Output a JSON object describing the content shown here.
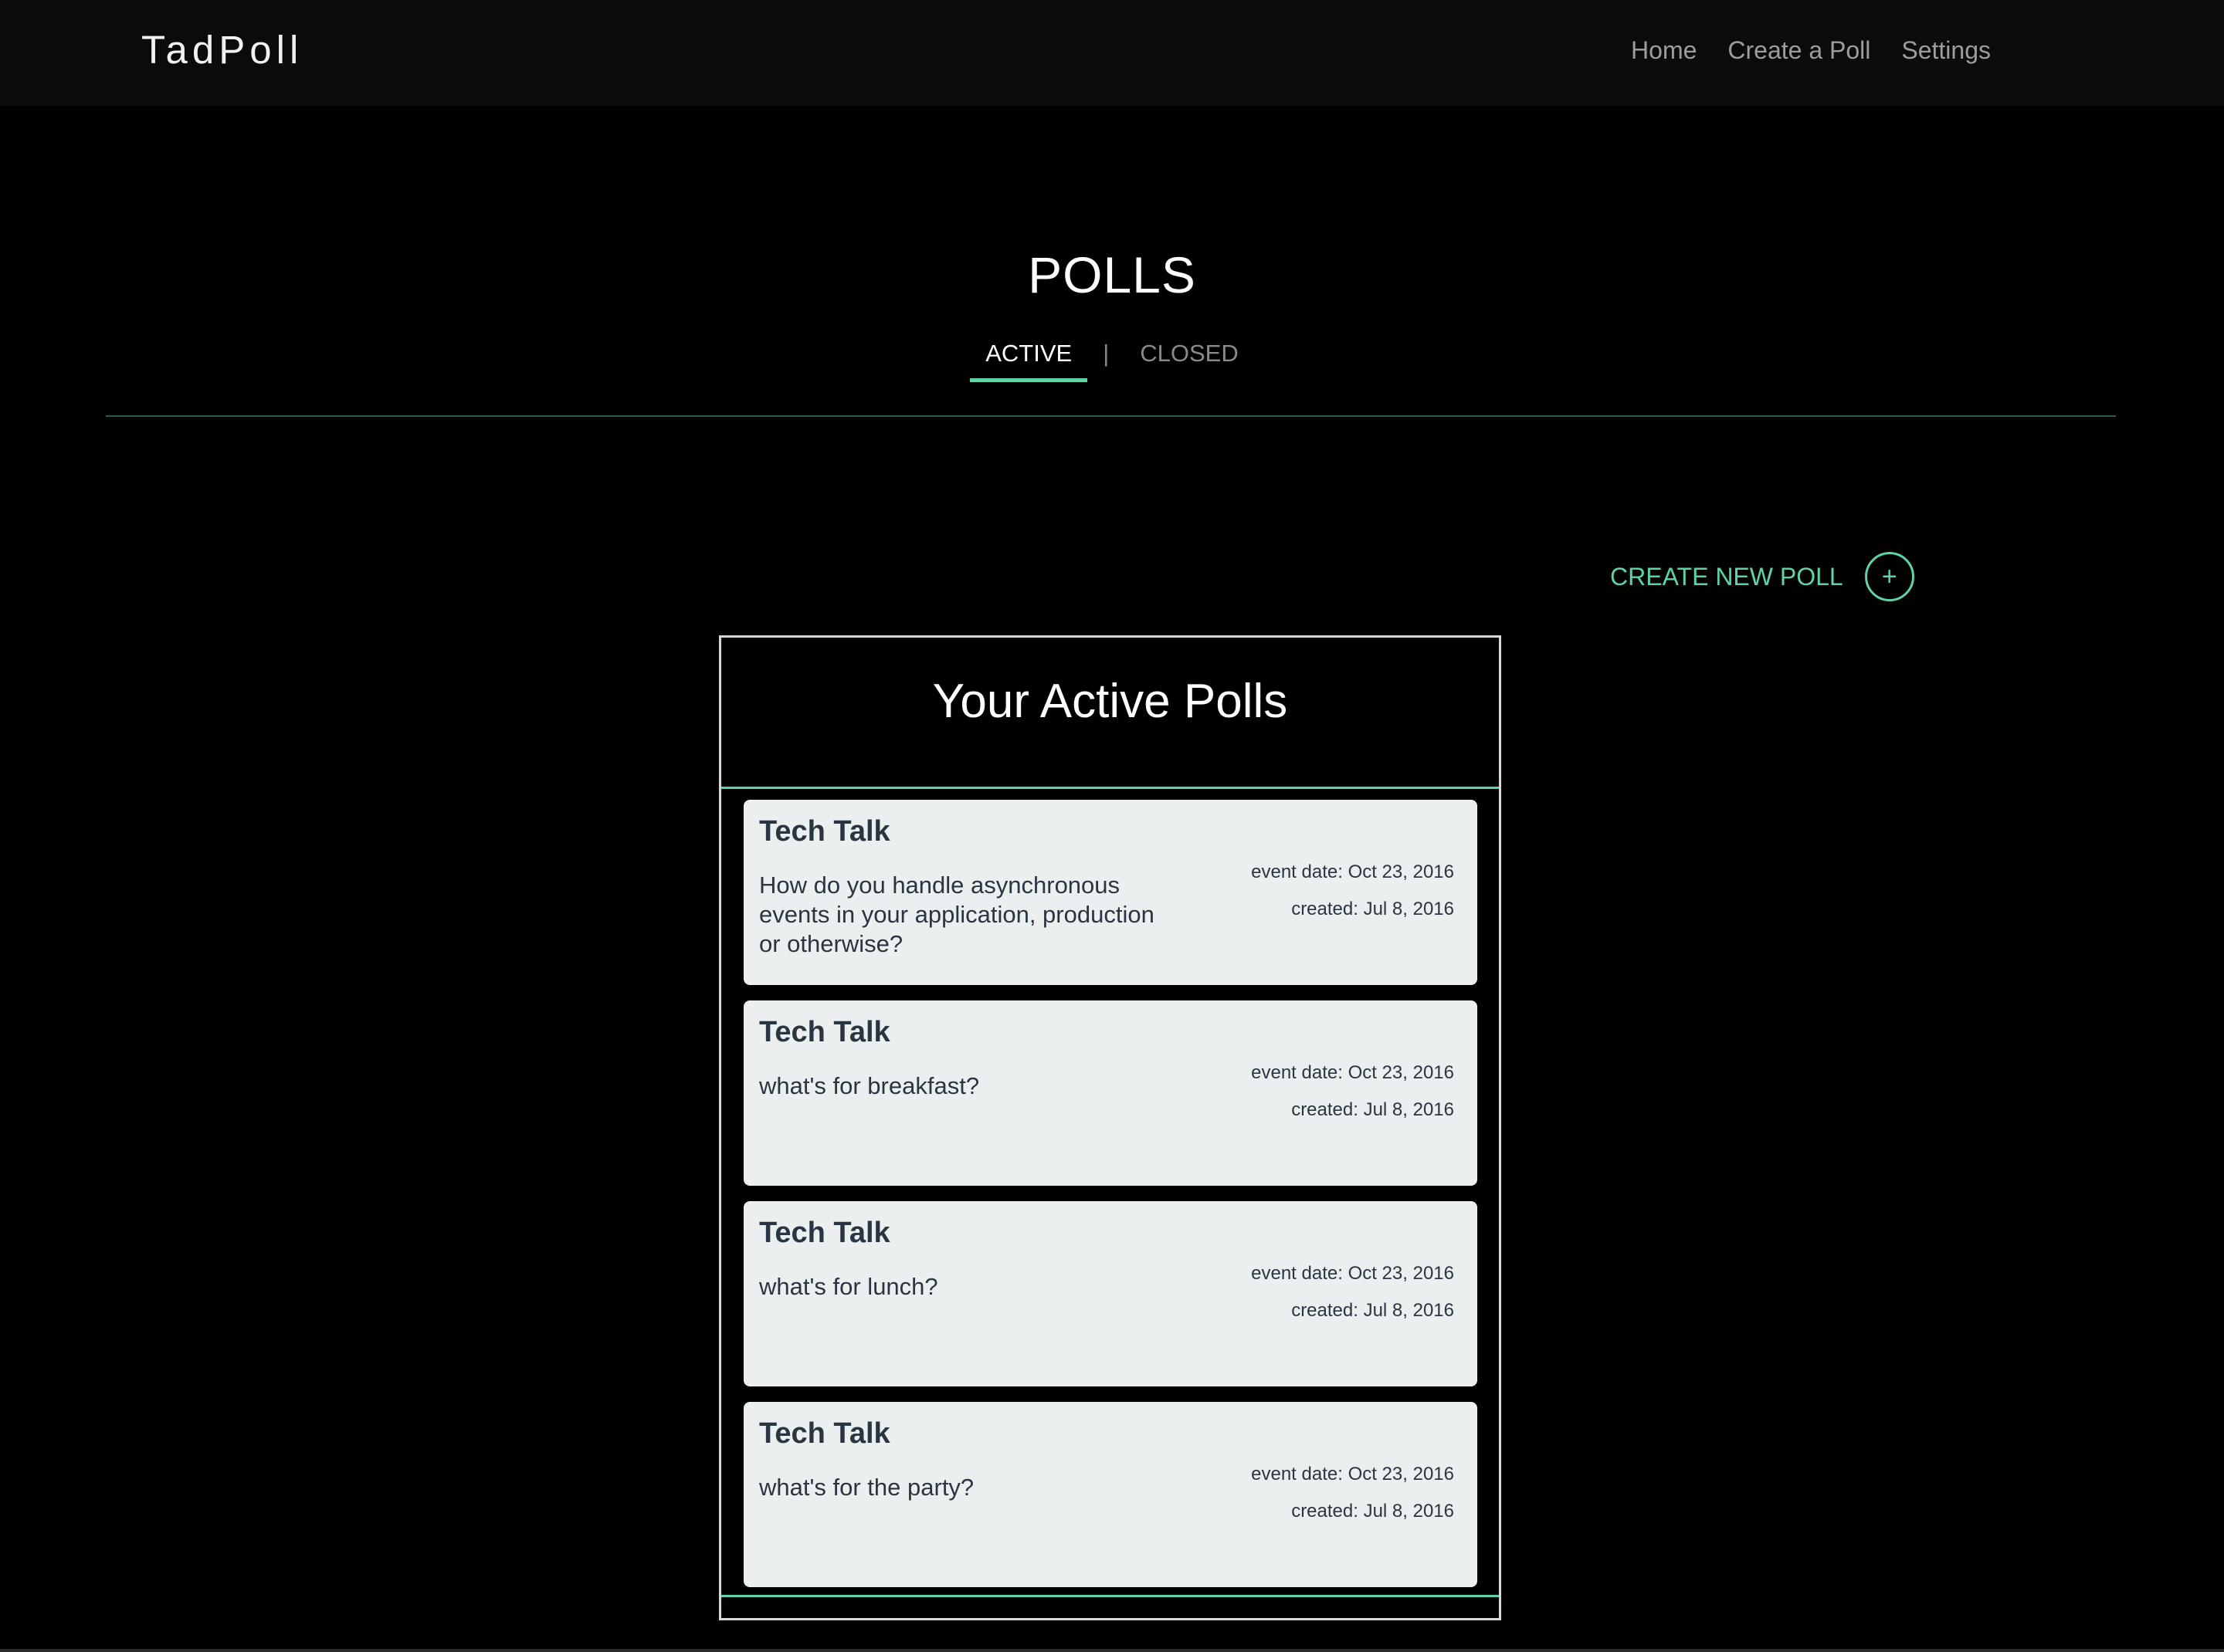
{
  "navbar": {
    "brand": "TadPoll",
    "links": [
      "Home",
      "Create a Poll",
      "Settings"
    ]
  },
  "page": {
    "title": "POLLS",
    "tabs": {
      "active": "ACTIVE",
      "separator": "|",
      "closed": "CLOSED"
    },
    "selected_tab": "ACTIVE"
  },
  "create_new": {
    "label": "CREATE NEW POLL",
    "icon": "plus-icon",
    "symbol": "+"
  },
  "panel": {
    "title": "Your Active Polls",
    "polls": [
      {
        "name": "Tech Talk",
        "question": "How do you handle asynchronous events in your application, production or otherwise?",
        "event_date": "event date: Oct 23, 2016",
        "created": "created: Jul 8, 2016"
      },
      {
        "name": "Tech Talk",
        "question": "what's for breakfast?",
        "event_date": "event date: Oct 23, 2016",
        "created": "created: Jul 8, 2016"
      },
      {
        "name": "Tech Talk",
        "question": "what's for lunch?",
        "event_date": "event date: Oct 23, 2016",
        "created": "created: Jul 8, 2016"
      },
      {
        "name": "Tech Talk",
        "question": "what's for the party?",
        "event_date": "event date: Oct 23, 2016",
        "created": "created: Jul 8, 2016"
      }
    ]
  },
  "colors": {
    "accent": "#5fd3a6",
    "background": "#000000",
    "navbar": "#0b0b0b",
    "card": "#eceff0",
    "card_text": "#2a3542"
  }
}
